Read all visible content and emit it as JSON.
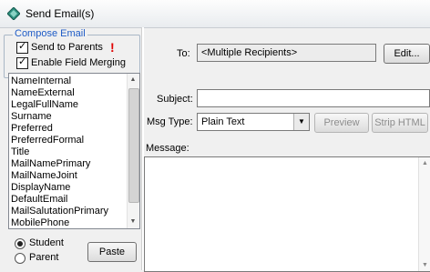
{
  "window": {
    "title": "Send Email(s)"
  },
  "compose": {
    "group_label": "Compose Email",
    "send_to_parents": {
      "label": "Send to Parents",
      "checked": true,
      "warning": "!"
    },
    "enable_field_merging": {
      "label": "Enable Field Merging",
      "checked": true
    },
    "fields": [
      "NameInternal",
      "NameExternal",
      "LegalFullName",
      "Surname",
      "Preferred",
      "PreferredFormal",
      "Title",
      "MailNamePrimary",
      "MailNameJoint",
      "DisplayName",
      "DefaultEmail",
      "MailSalutationPrimary",
      "MobilePhone"
    ],
    "recipient_type": {
      "options": [
        "Student",
        "Parent"
      ],
      "selected": "Student"
    },
    "paste_label": "Paste"
  },
  "form": {
    "to_label": "To:",
    "to_value": "<Multiple Recipients>",
    "edit_label": "Edit...",
    "subject_label": "Subject:",
    "subject_value": "",
    "msg_type_label": "Msg Type:",
    "msg_type_value": "Plain Text",
    "preview_label": "Preview",
    "strip_html_label": "Strip HTML",
    "message_label": "Message:",
    "message_value": ""
  }
}
